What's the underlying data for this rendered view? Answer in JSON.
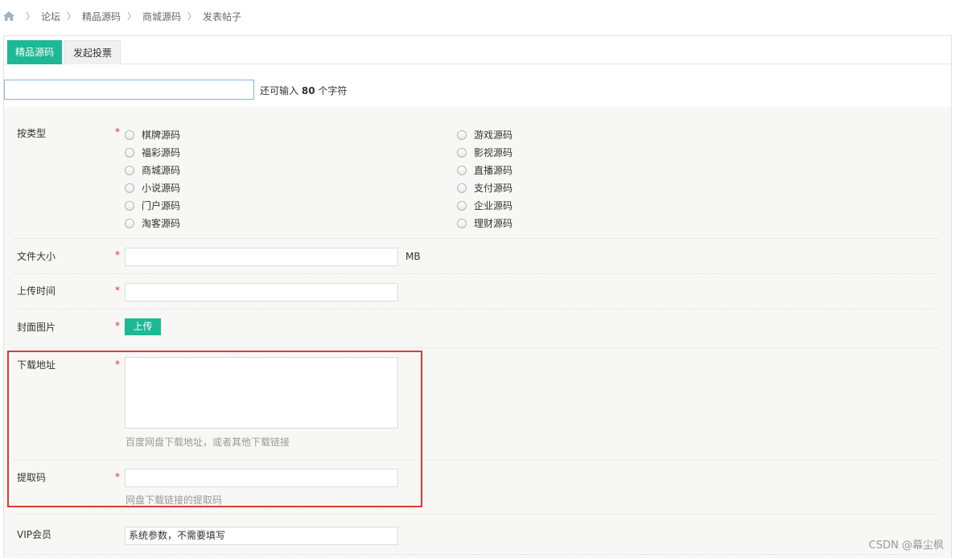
{
  "breadcrumb": {
    "items": [
      "论坛",
      "精品源码",
      "商城源码",
      "发表帖子"
    ]
  },
  "tabs": [
    {
      "label": "精品源码"
    },
    {
      "label": "发起投票"
    }
  ],
  "subject": {
    "value": "",
    "hint_prefix": "还可输入",
    "hint_count": "80",
    "hint_suffix": "个字符"
  },
  "form": {
    "required_mark": "*",
    "category": {
      "label": "按类型",
      "options_left": [
        "棋牌源码",
        "福彩源码",
        "商城源码",
        "小说源码",
        "门户源码",
        "淘客源码"
      ],
      "options_right": [
        "游戏源码",
        "影视源码",
        "直播源码",
        "支付源码",
        "企业源码",
        "理财源码"
      ]
    },
    "file_size": {
      "label": "文件大小",
      "unit": "MB",
      "value": ""
    },
    "upload_time": {
      "label": "上传时间",
      "value": ""
    },
    "cover_image": {
      "label": "封面图片",
      "button": "上传"
    },
    "download_url": {
      "label": "下载地址",
      "value": "",
      "hint": "百度网盘下载地址，或者其他下载链接"
    },
    "extract_code": {
      "label": "提取码",
      "value": "",
      "hint": "网盘下载链接的提取码"
    },
    "vip": {
      "label": "VIP会员",
      "value": "系统参数，不需要填写"
    }
  },
  "watermark": "CSDN @幕尘枫",
  "colors": {
    "accent": "#1fb895",
    "required": "#e0312c",
    "highlight": "#e53935",
    "panel_bg": "#f7f7f5"
  }
}
